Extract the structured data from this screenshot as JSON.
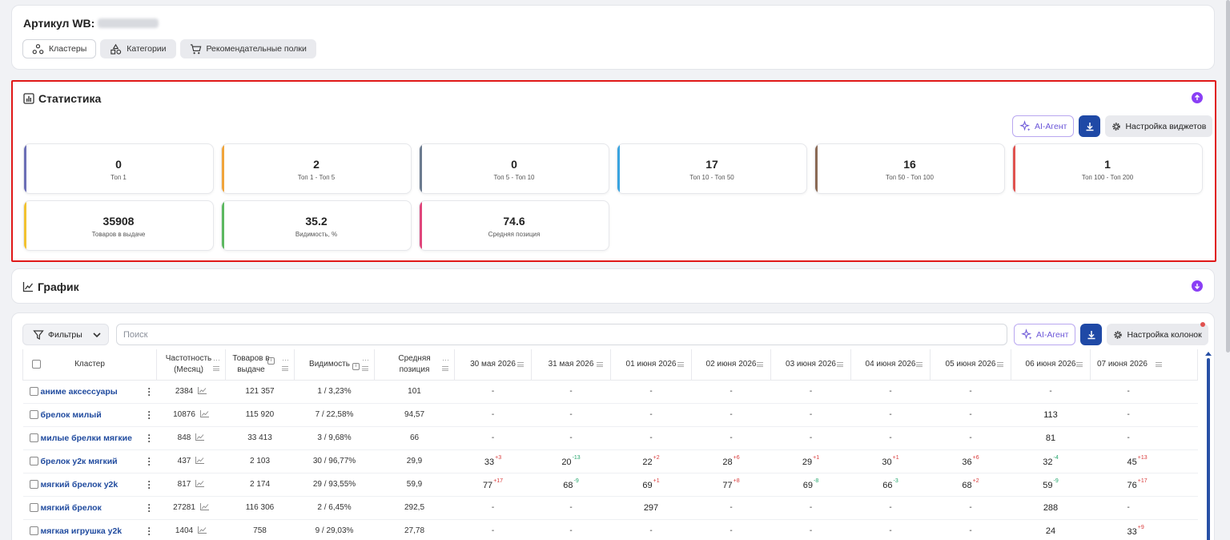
{
  "header": {
    "sku_label": "Артикул WB:",
    "tabs": [
      {
        "label": "Кластеры",
        "icon": "clusters-icon",
        "active": true
      },
      {
        "label": "Категории",
        "icon": "categories-icon",
        "active": false
      },
      {
        "label": "Рекомендательные полки",
        "icon": "cart-icon",
        "active": false
      }
    ]
  },
  "stats": {
    "title": "Статистика",
    "ai_label": "AI-Агент",
    "settings_label": "Настройка виджетов",
    "metrics": [
      {
        "value": "0",
        "label": "Топ 1",
        "color": "#6c6fb6"
      },
      {
        "value": "2",
        "label": "Топ 1 - Топ 5",
        "color": "#f0a43a"
      },
      {
        "value": "0",
        "label": "Топ 5 - Топ 10",
        "color": "#6b7b8f"
      },
      {
        "value": "17",
        "label": "Топ 10 - Топ 50",
        "color": "#3aa4e0"
      },
      {
        "value": "16",
        "label": "Топ 50 - Топ 100",
        "color": "#8b6a55"
      },
      {
        "value": "1",
        "label": "Топ 100 - Топ 200",
        "color": "#e0524f"
      },
      {
        "value": "35908",
        "label": "Товаров в выдаче",
        "color": "#f2c230"
      },
      {
        "value": "35.2",
        "label": "Видимость, %",
        "color": "#5cb860"
      },
      {
        "value": "74.6",
        "label": "Средняя позиция",
        "color": "#e0457b"
      }
    ]
  },
  "graph": {
    "title": "График"
  },
  "table": {
    "filters_label": "Фильтры",
    "search_placeholder": "Поиск",
    "ai_label": "AI-Агент",
    "settings_label": "Настройка колонок",
    "columns": {
      "cluster": "Кластер",
      "frequency": "Частотность (Месяц)",
      "products": "Товаров в выдаче",
      "visibility": "Видимость",
      "avg_pos": "Средняя позиция",
      "dates": [
        "30 мая 2026",
        "31 мая 2026",
        "01 июня 2026",
        "02 июня 2026",
        "03 июня 2026",
        "04 июня 2026",
        "05 июня 2026",
        "06 июня 2026",
        "07 июня 2026"
      ]
    },
    "rows": [
      {
        "name": "аниме аксессуары",
        "freq": "2384",
        "products": "121 357",
        "visibility": "1 / 3,23%",
        "avg": "101",
        "cells": [
          {
            "v": "-"
          },
          {
            "v": "-"
          },
          {
            "v": "-"
          },
          {
            "v": "-"
          },
          {
            "v": "-"
          },
          {
            "v": "-"
          },
          {
            "v": "-"
          },
          {
            "v": "-"
          },
          {
            "v": "-"
          }
        ]
      },
      {
        "name": "брелок милый",
        "freq": "10876",
        "products": "115 920",
        "visibility": "7 / 22,58%",
        "avg": "94,57",
        "cells": [
          {
            "v": "-"
          },
          {
            "v": "-"
          },
          {
            "v": "-"
          },
          {
            "v": "-"
          },
          {
            "v": "-"
          },
          {
            "v": "-"
          },
          {
            "v": "-"
          },
          {
            "v": "113"
          },
          {
            "v": "-"
          }
        ]
      },
      {
        "name": "милые брелки мягкие",
        "freq": "848",
        "products": "33 413",
        "visibility": "3 / 9,68%",
        "avg": "66",
        "cells": [
          {
            "v": "-"
          },
          {
            "v": "-"
          },
          {
            "v": "-"
          },
          {
            "v": "-"
          },
          {
            "v": "-"
          },
          {
            "v": "-"
          },
          {
            "v": "-"
          },
          {
            "v": "81"
          },
          {
            "v": "-"
          }
        ]
      },
      {
        "name": "брелок у2к мягкий",
        "freq": "437",
        "products": "2 103",
        "visibility": "30 / 96,77%",
        "avg": "29,9",
        "cells": [
          {
            "v": "33",
            "d": "+3",
            "t": "up"
          },
          {
            "v": "20",
            "d": "-13",
            "t": "dn"
          },
          {
            "v": "22",
            "d": "+2",
            "t": "up"
          },
          {
            "v": "28",
            "d": "+6",
            "t": "up"
          },
          {
            "v": "29",
            "d": "+1",
            "t": "up"
          },
          {
            "v": "30",
            "d": "+1",
            "t": "up"
          },
          {
            "v": "36",
            "d": "+6",
            "t": "up"
          },
          {
            "v": "32",
            "d": "-4",
            "t": "dn"
          },
          {
            "v": "45",
            "d": "+13",
            "t": "up"
          }
        ]
      },
      {
        "name": "мягкий брелок у2k",
        "freq": "817",
        "products": "2 174",
        "visibility": "29 / 93,55%",
        "avg": "59,9",
        "cells": [
          {
            "v": "77",
            "d": "+17",
            "t": "up"
          },
          {
            "v": "68",
            "d": "-9",
            "t": "dn"
          },
          {
            "v": "69",
            "d": "+1",
            "t": "up"
          },
          {
            "v": "77",
            "d": "+8",
            "t": "up"
          },
          {
            "v": "69",
            "d": "-8",
            "t": "dn"
          },
          {
            "v": "66",
            "d": "-3",
            "t": "dn"
          },
          {
            "v": "68",
            "d": "+2",
            "t": "up"
          },
          {
            "v": "59",
            "d": "-9",
            "t": "dn"
          },
          {
            "v": "76",
            "d": "+17",
            "t": "up"
          }
        ]
      },
      {
        "name": "мягкий брелок",
        "freq": "27281",
        "products": "116 306",
        "visibility": "2 / 6,45%",
        "avg": "292,5",
        "cells": [
          {
            "v": "-"
          },
          {
            "v": "-"
          },
          {
            "v": "297"
          },
          {
            "v": "-"
          },
          {
            "v": "-"
          },
          {
            "v": "-"
          },
          {
            "v": "-"
          },
          {
            "v": "288"
          },
          {
            "v": "-"
          }
        ]
      },
      {
        "name": "мягкая игрушка у2k",
        "freq": "1404",
        "products": "758",
        "visibility": "9 / 29,03%",
        "avg": "27,78",
        "cells": [
          {
            "v": "-"
          },
          {
            "v": "-"
          },
          {
            "v": "-"
          },
          {
            "v": "-"
          },
          {
            "v": "-"
          },
          {
            "v": "-"
          },
          {
            "v": "-"
          },
          {
            "v": "24"
          },
          {
            "v": "33",
            "d": "+9",
            "t": "up"
          }
        ]
      }
    ]
  }
}
